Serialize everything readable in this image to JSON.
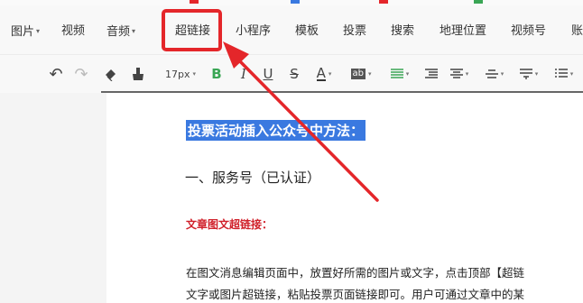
{
  "menubar": {
    "items": [
      {
        "label": "图片",
        "dropdown": true
      },
      {
        "label": "视频",
        "dropdown": false
      },
      {
        "label": "音频",
        "dropdown": true
      },
      {
        "label": "超链接",
        "dropdown": false
      },
      {
        "label": "小程序",
        "dropdown": false
      },
      {
        "label": "模板",
        "dropdown": false
      },
      {
        "label": "投票",
        "dropdown": false
      },
      {
        "label": "搜索",
        "dropdown": false
      },
      {
        "label": "地理位置",
        "dropdown": false
      },
      {
        "label": "视频号",
        "dropdown": false
      },
      {
        "label": "账",
        "dropdown": false
      }
    ],
    "caret_glyph": "▾",
    "highlighted_item": "超链接",
    "highlight_color": "#e4262a"
  },
  "toolbar": {
    "undo_glyph": "↶",
    "redo_glyph": "↷",
    "font_size": "17px",
    "bold_glyph": "B",
    "italic_glyph": "I",
    "underline_glyph": "U",
    "strike_glyph": "S",
    "font_color_glyph": "A",
    "bg_color_glyph": "ab",
    "caret_glyph": "▾",
    "bold_color": "#3aa655",
    "font_color_bar": "#333333"
  },
  "document": {
    "selected_heading": "投票活动插入公众号中方法：",
    "section_heading": "一、服务号（已认证）",
    "subheading": "文章图文超链接：",
    "paragraph_line1": "在图文消息编辑页面中，放置好所需的图片或文字，点击顶部【超链",
    "paragraph_line2": "文字或图片超链接，粘贴投票页面链接即可。用户可通过文章中的某",
    "selection_color": "#3a79e0",
    "subheading_color": "#d0202a"
  },
  "annotation": {
    "arrow_color": "#e4262a"
  }
}
